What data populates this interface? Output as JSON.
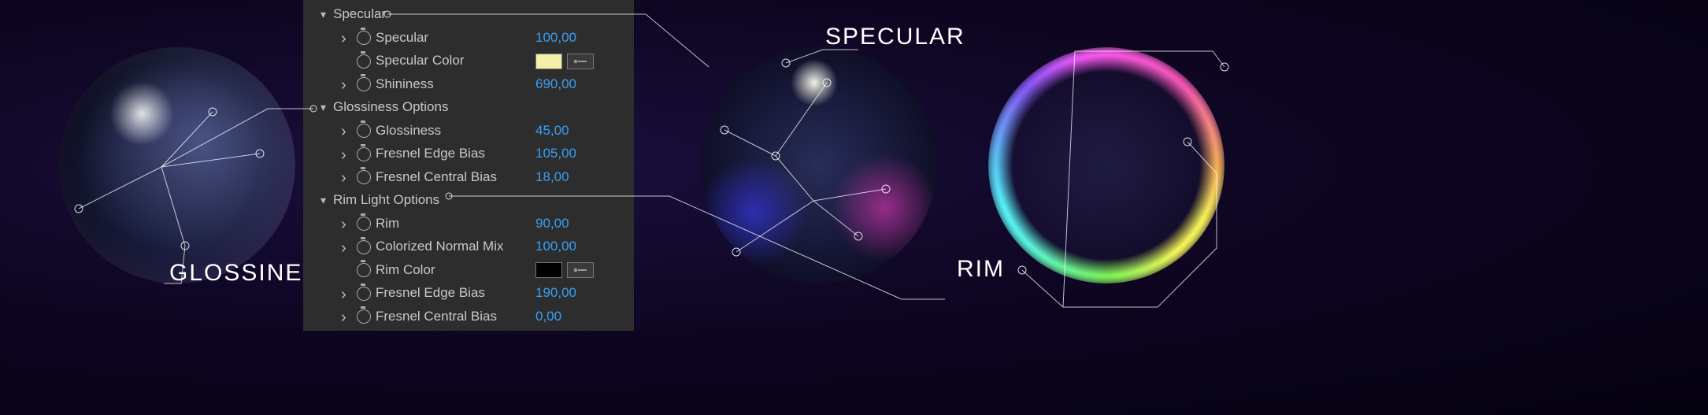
{
  "labels": {
    "glossiness": "GLOSSINESS",
    "specular": "SPECULAR",
    "rim": "RIM"
  },
  "panel": {
    "groups": [
      {
        "name": "Specular",
        "props": [
          {
            "name": "Specular",
            "value": "100,00",
            "expand": true
          },
          {
            "name": "Specular Color",
            "color": "#f5f0a8",
            "expand": false
          },
          {
            "name": "Shininess",
            "value": "690,00",
            "expand": true
          }
        ]
      },
      {
        "name": "Glossiness Options",
        "props": [
          {
            "name": "Glossiness",
            "value": "45,00",
            "expand": true
          },
          {
            "name": "Fresnel Edge Bias",
            "value": "105,00",
            "expand": true
          },
          {
            "name": "Fresnel Central Bias",
            "value": "18,00",
            "expand": true
          }
        ]
      },
      {
        "name": "Rim Light Options",
        "props": [
          {
            "name": "Rim",
            "value": "90,00",
            "expand": true
          },
          {
            "name": "Colorized Normal Mix",
            "value": "100,00",
            "expand": true
          },
          {
            "name": "Rim Color",
            "color": "#000000",
            "expand": false
          },
          {
            "name": "Fresnel Edge Bias",
            "value": "190,00",
            "expand": true
          },
          {
            "name": "Fresnel Central Bias",
            "value": "0,00",
            "expand": true
          }
        ]
      }
    ]
  }
}
